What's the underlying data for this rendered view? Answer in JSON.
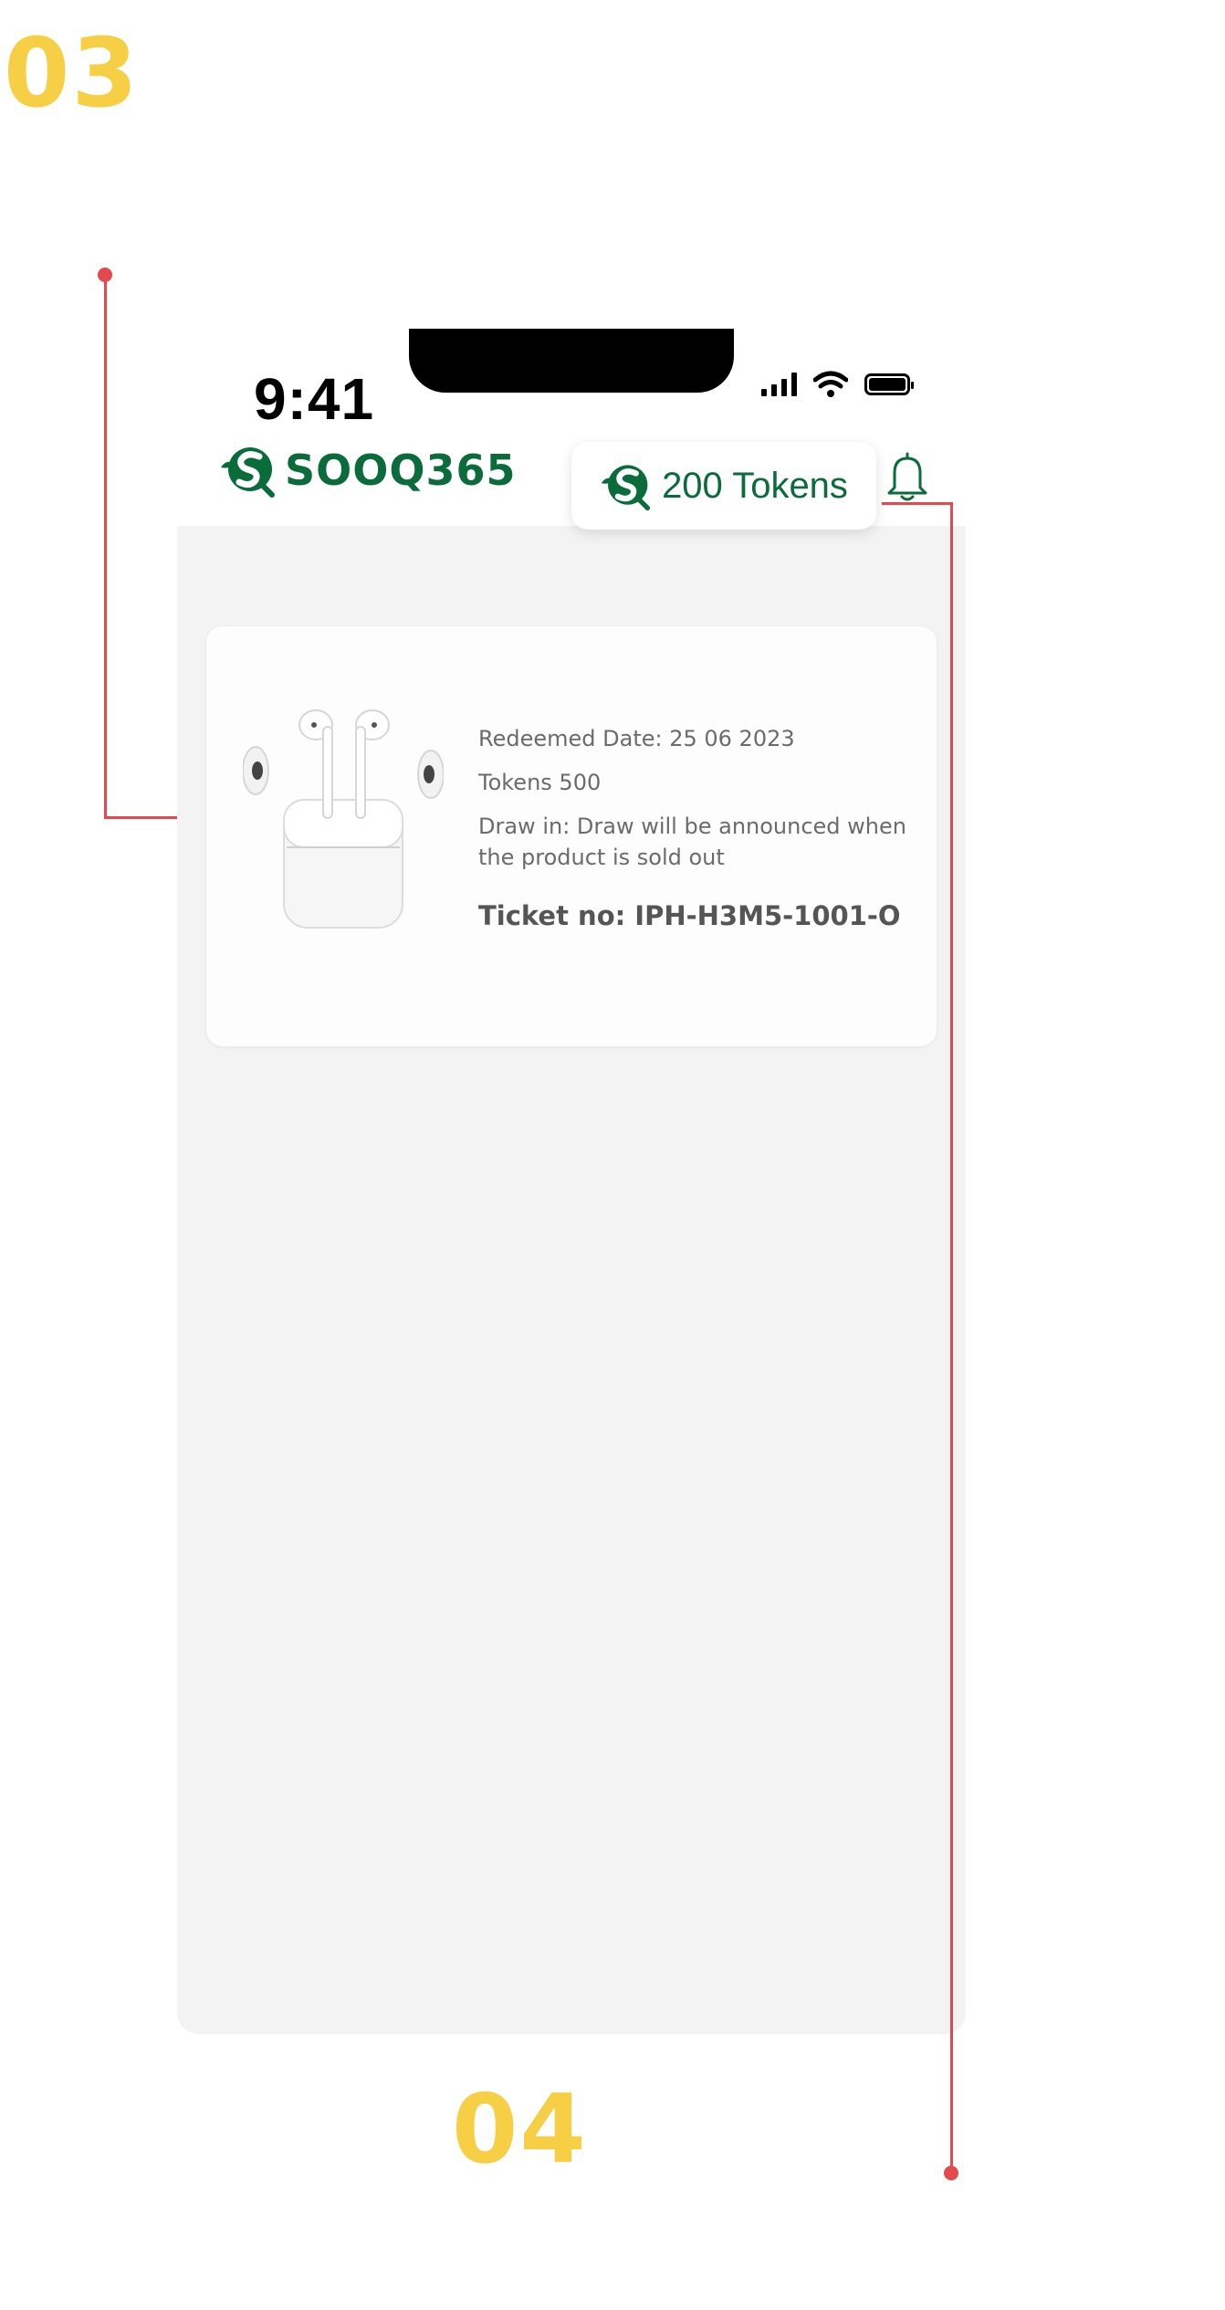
{
  "steps": {
    "top": "03",
    "bottom": "04"
  },
  "status_bar": {
    "time": "9:41",
    "icons": [
      "signal-icon",
      "wifi-icon",
      "battery-icon"
    ]
  },
  "header": {
    "logo_text": "SOOQ365",
    "tokens_label": "200 Tokens",
    "bell_icon": "bell-icon"
  },
  "ticket": {
    "product_image": "airpods-image",
    "redeemed_date": "Redeemed Date: 25 06 2023",
    "tokens": "Tokens 500",
    "draw_info": "Draw in: Draw will be announced when the product is sold out",
    "ticket_no": "Ticket no: IPH-H3M5-1001-O"
  },
  "colors": {
    "brand_green": "#0a6b3b",
    "step_yellow": "#f7cf45",
    "annotation_red": "#e5484d",
    "screen_bg": "#f3f3f3"
  }
}
